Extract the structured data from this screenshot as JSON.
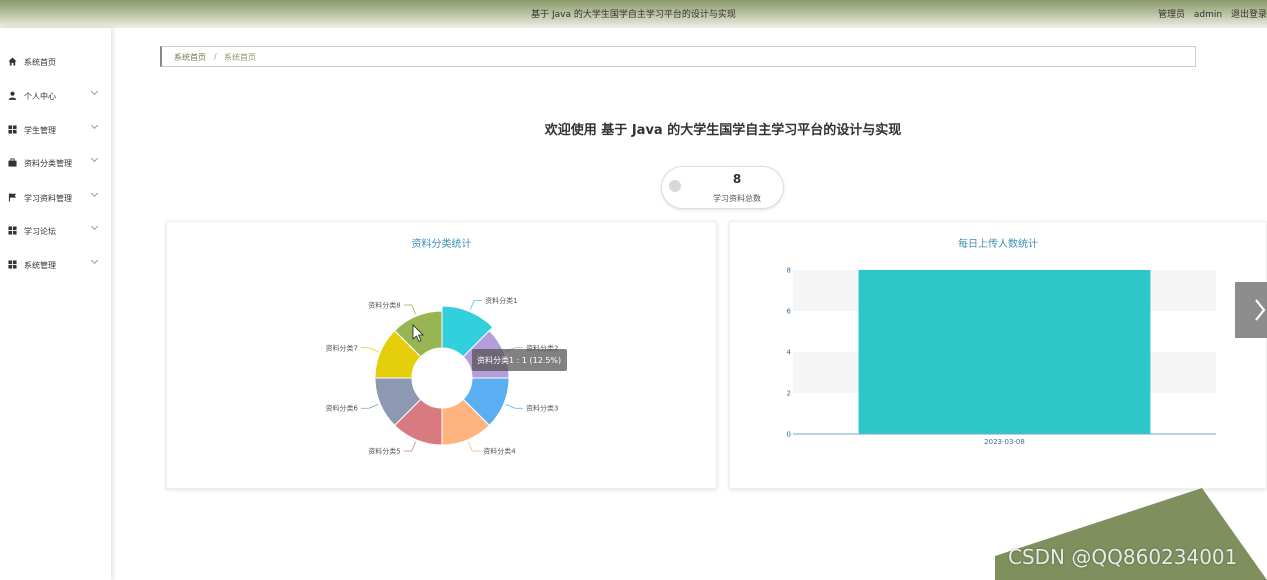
{
  "header": {
    "title": "基于 Java 的大学生国学自主学习平台的设计与实现",
    "user_role": "管理员",
    "user_name": "admin",
    "logout": "退出登录"
  },
  "sidebar": {
    "items": [
      {
        "label": "系统首页",
        "icon": "home-icon"
      },
      {
        "label": "个人中心",
        "icon": "user-icon"
      },
      {
        "label": "学生管理",
        "icon": "grid-icon"
      },
      {
        "label": "资料分类管理",
        "icon": "briefcase-icon"
      },
      {
        "label": "学习资料管理",
        "icon": "flag-icon"
      },
      {
        "label": "学习论坛",
        "icon": "grid-icon"
      },
      {
        "label": "系统管理",
        "icon": "grid-icon"
      }
    ]
  },
  "breadcrumb": {
    "home": "系统首页",
    "separator": "/",
    "current": "系统首页"
  },
  "welcome": "欢迎使用 基于 Java 的大学生国学自主学习平台的设计与实现",
  "stat": {
    "value": "8",
    "label": "学习资料总数"
  },
  "pie_card": {
    "title": "资料分类统计",
    "tooltip": "资料分类1 : 1 (12.5%)"
  },
  "bar_card": {
    "title": "每日上传人数统计"
  },
  "watermark": "CSDN @QQ860234001",
  "colors": {
    "accent": "#6b7a4b",
    "title_blue": "#3a8fb7",
    "bar": "#2ec7c9"
  },
  "chart_data": [
    {
      "type": "pie",
      "title": "资料分类统计",
      "categories": [
        "资料分类1",
        "资料分类2",
        "资料分类3",
        "资料分类4",
        "资料分类5",
        "资料分类6",
        "资料分类7",
        "资料分类8"
      ],
      "values": [
        1,
        1,
        1,
        1,
        1,
        1,
        1,
        1
      ],
      "colors": [
        "#32d0dc",
        "#b39ddb",
        "#5aaef1",
        "#ffb37d",
        "#d87a80",
        "#8d98b3",
        "#e5cf0d",
        "#97b552"
      ]
    },
    {
      "type": "bar",
      "title": "每日上传人数统计",
      "categories": [
        "2023-03-08"
      ],
      "values": [
        8
      ],
      "ylim": [
        0,
        8
      ],
      "yticks": [
        0,
        2,
        4,
        6,
        8
      ],
      "color": "#2ec7c9"
    }
  ]
}
